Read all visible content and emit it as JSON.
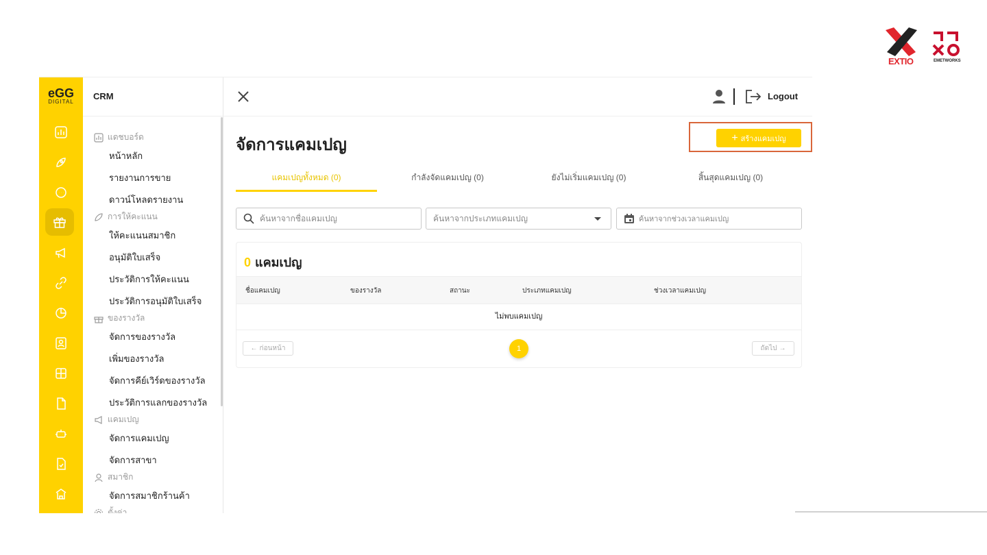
{
  "logos": {
    "left_brand": "EXTIO",
    "right_brand": "EMETWORKS"
  },
  "rail": {
    "logo_top": "eGG",
    "logo_bottom": "DIGITAL",
    "icons": [
      "chart-icon",
      "rocket-icon",
      "chat-icon",
      "gift-icon",
      "megaphone-icon",
      "link-icon",
      "pie-chart-icon",
      "contact-card-icon",
      "grid-icon",
      "document-icon",
      "robot-icon",
      "document-check-icon",
      "store-icon"
    ],
    "active_index": 3
  },
  "menu": {
    "title": "CRM",
    "sections": [
      {
        "label": "แดชบอร์ด",
        "icon": "chart-icon",
        "items": [
          "หน้าหลัก",
          "รายงานการขาย",
          "ดาวน์โหลดรายงาน"
        ]
      },
      {
        "label": "การให้คะแนน",
        "icon": "rocket-icon",
        "items": [
          "ให้คะแนนสมาชิก",
          "อนุมัติใบเสร็จ",
          "ประวัติการให้คะแนน",
          "ประวัติการอนุมัติใบเสร็จ"
        ]
      },
      {
        "label": "ของรางวัล",
        "icon": "gift-icon",
        "items": [
          "จัดการของรางวัล",
          "เพิ่มของรางวัล",
          "จัดการคีย์เวิร์ดของรางวัล",
          "ประวัติการแลกของรางวัล"
        ]
      },
      {
        "label": "แคมเปญ",
        "icon": "megaphone-icon",
        "items": [
          "จัดการแคมเปญ",
          "จัดการสาขา"
        ]
      },
      {
        "label": "สมาชิก",
        "icon": "user-icon",
        "items": [
          "จัดการสมาชิกร้านค้า"
        ]
      },
      {
        "label": "ตั้งค่า",
        "icon": "gear-icon",
        "items": []
      }
    ]
  },
  "topbar": {
    "logout_label": "Logout"
  },
  "page": {
    "title": "จัดการแคมเปญ",
    "create_label": "สร้างแคมเปญ",
    "tabs": [
      {
        "label": "แคมเปญทั้งหมด (0)",
        "active": true
      },
      {
        "label": "กำลังจัดแคมเปญ (0)",
        "active": false
      },
      {
        "label": "ยังไม่เริ่มแคมเปญ (0)",
        "active": false
      },
      {
        "label": "สิ้นสุดแคมเปญ (0)",
        "active": false
      }
    ],
    "filters": {
      "search_placeholder": "ค้นหาจากชื่อแคมเปญ",
      "type_placeholder": "ค้นหาจากประเภทแคมเปญ",
      "date_placeholder": "ค้นหาจากช่วงเวลาแคมเปญ"
    },
    "card": {
      "count": "0",
      "count_label": "แคมเปญ",
      "columns": [
        "ชื่อแคมเปญ",
        "ของรางวัล",
        "สถานะ",
        "ประเภทแคมเปญ",
        "ช่วงเวลาแคมเปญ"
      ],
      "empty_text": "ไม่พบแคมเปญ",
      "prev_label": "ก่อนหน้า",
      "next_label": "ถัดไป",
      "current_page": "1"
    }
  },
  "colors": {
    "accent": "#ffd200",
    "highlight_border": "#d9663a",
    "text": "#222222"
  }
}
